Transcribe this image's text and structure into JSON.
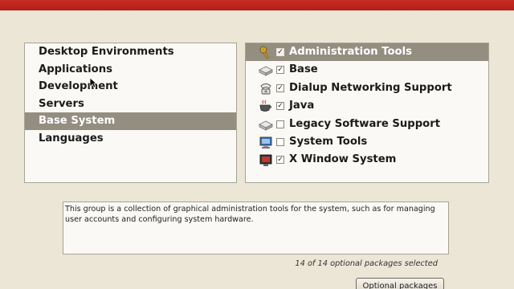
{
  "groups": {
    "items": [
      {
        "label": "Desktop Environments"
      },
      {
        "label": "Applications"
      },
      {
        "label": "Development"
      },
      {
        "label": "Servers"
      },
      {
        "label": "Base System"
      },
      {
        "label": "Languages"
      }
    ],
    "selected_index": 4
  },
  "packages": {
    "items": [
      {
        "label": "Administration Tools",
        "checked": true,
        "icon": "keys-icon"
      },
      {
        "label": "Base",
        "checked": true,
        "icon": "drive-icon"
      },
      {
        "label": "Dialup Networking Support",
        "checked": true,
        "icon": "phone-icon"
      },
      {
        "label": "Java",
        "checked": true,
        "icon": "coffee-cup-icon"
      },
      {
        "label": "Legacy Software Support",
        "checked": false,
        "icon": "drive-icon"
      },
      {
        "label": "System Tools",
        "checked": false,
        "icon": "monitor-icon"
      },
      {
        "label": "X Window System",
        "checked": true,
        "icon": "x-window-icon"
      }
    ],
    "selected_index": 0
  },
  "description": "This group is a collection of graphical administration tools for the system, such as for managing user accounts and configuring system hardware.",
  "status": "14 of 14 optional packages selected",
  "optional_button_label": "Optional packages",
  "check_glyph": "✓",
  "colors": {
    "header": "#c62b24",
    "selection": "#938e80",
    "background": "#ece6d7"
  }
}
